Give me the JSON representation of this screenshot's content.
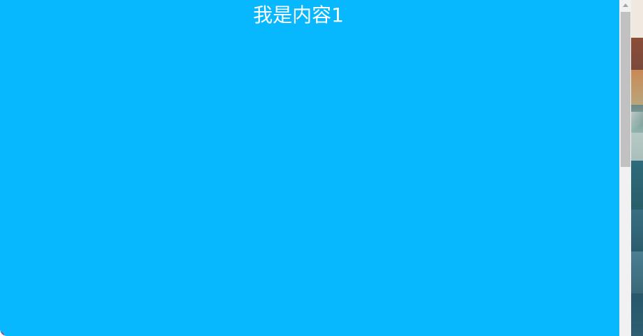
{
  "content": {
    "title": "我是内容1"
  },
  "colors": {
    "panel_background": "#08b8ff",
    "title_text": "#ffffff",
    "scrollbar_track": "#f1f1f1",
    "scrollbar_thumb": "#c1c1c1"
  },
  "icons": {
    "scroll_up": "scroll-up-arrow-icon"
  }
}
